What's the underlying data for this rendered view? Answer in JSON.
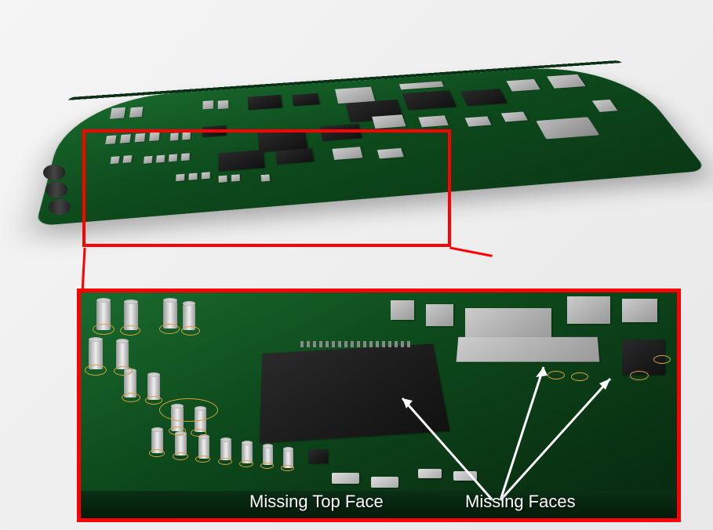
{
  "diagram": {
    "type": "3D CAD rendering",
    "subject": "Printed circuit board with surface-mount components",
    "views": {
      "top": {
        "description": "Isometric 3D view of full PCB",
        "highlight_region": "Central-left area of board"
      },
      "detail": {
        "description": "Zoomed detail of highlighted region",
        "defects_shown": [
          "Missing Top Face",
          "Missing Faces"
        ]
      }
    },
    "annotations": {
      "label1": "Missing Top Face",
      "label2": "Missing Faces"
    },
    "colors": {
      "pcb_green": "#0d4a1c",
      "highlight_red": "#ff0000",
      "component_gray": "#888888",
      "component_dark": "#1a1a1a",
      "arrow_white": "#ffffff",
      "circle_gold": "#d4a040"
    }
  }
}
